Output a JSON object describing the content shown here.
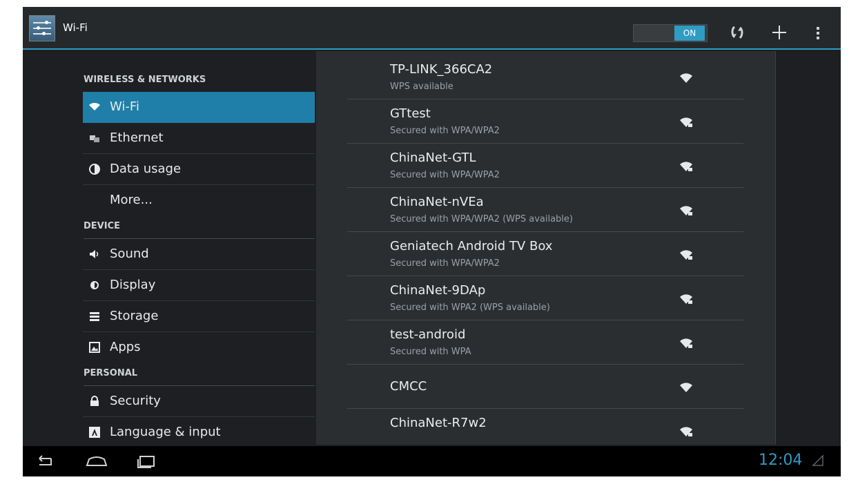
{
  "action_bar": {
    "title": "Wi-Fi",
    "toggle_label": "ON",
    "icons": [
      "settings-app-icon",
      "scan-icon",
      "add-network-icon",
      "overflow-menu-icon"
    ],
    "accent_color": "#2f9cc4"
  },
  "sidebar": {
    "sections": [
      {
        "header": "WIRELESS & NETWORKS",
        "items": [
          {
            "label": "Wi-Fi",
            "icon": "wifi-icon",
            "selected": true
          },
          {
            "label": "Ethernet",
            "icon": "ethernet-icon"
          },
          {
            "label": "Data usage",
            "icon": "data-usage-icon"
          },
          {
            "label": "More...",
            "icon": ""
          }
        ]
      },
      {
        "header": "DEVICE",
        "items": [
          {
            "label": "Sound",
            "icon": "sound-icon"
          },
          {
            "label": "Display",
            "icon": "display-icon"
          },
          {
            "label": "Storage",
            "icon": "storage-icon"
          },
          {
            "label": "Apps",
            "icon": "apps-icon"
          }
        ]
      },
      {
        "header": "PERSONAL",
        "items": [
          {
            "label": "Security",
            "icon": "lock-icon"
          },
          {
            "label": "Language & input",
            "icon": "language-icon"
          }
        ]
      }
    ]
  },
  "networks": [
    {
      "ssid": "TP-LINK_366CA2",
      "summary": "WPS available",
      "secured": false
    },
    {
      "ssid": "GTtest",
      "summary": "Secured with WPA/WPA2",
      "secured": true
    },
    {
      "ssid": "ChinaNet-GTL",
      "summary": "Secured with WPA/WPA2",
      "secured": true
    },
    {
      "ssid": "ChinaNet-nVEa",
      "summary": "Secured with WPA/WPA2 (WPS available)",
      "secured": true
    },
    {
      "ssid": "Geniatech Android TV Box",
      "summary": "Secured with WPA/WPA2",
      "secured": true
    },
    {
      "ssid": "ChinaNet-9DAp",
      "summary": "Secured with WPA2 (WPS available)",
      "secured": true
    },
    {
      "ssid": "test-android",
      "summary": "Secured with WPA",
      "secured": true
    },
    {
      "ssid": "CMCC",
      "summary": "",
      "secured": false
    },
    {
      "ssid": "ChinaNet-R7w2",
      "summary": "",
      "secured": true
    }
  ],
  "system_bar": {
    "time": "12:04",
    "buttons": [
      "back-icon",
      "home-icon",
      "recent-apps-icon"
    ]
  }
}
